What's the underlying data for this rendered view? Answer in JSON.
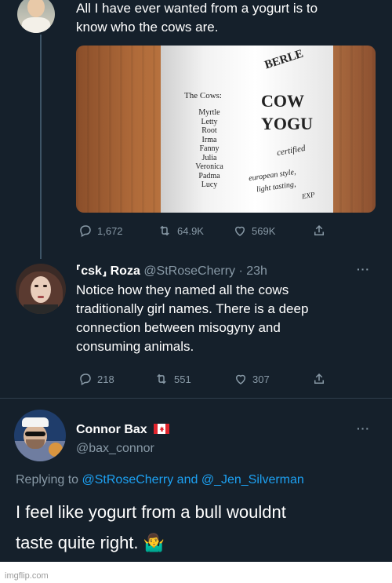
{
  "tweet1": {
    "text_line1": "All I have ever wanted from a yogurt is to",
    "text_line2": "know who the cows are.",
    "image": {
      "cows_heading": "The Cows:",
      "cow_names": [
        "Myrtle",
        "Letty",
        "Root",
        "Irma",
        "Fanny",
        "Julia",
        "Veronica",
        "Padma",
        "Lucy"
      ],
      "brand_top": "BERLE",
      "brand_line1": "COW",
      "brand_line2": "YOGU",
      "certified": "certified",
      "style_line1": "european style,",
      "style_line2": "light tasting,",
      "style_line3": "EXP"
    },
    "actions": {
      "reply": "1,672",
      "retweet": "64.9K",
      "like": "569K"
    }
  },
  "tweet2": {
    "display_name": "⸢csk⸥ Roza",
    "handle": "@StRoseCherry",
    "time": "· 23h",
    "more": "···",
    "text_lines": [
      "Notice how they named all the cows",
      "traditionally girl names. There is a deep",
      "connection between misogyny and",
      "consuming animals."
    ],
    "actions": {
      "reply": "218",
      "retweet": "551",
      "like": "307"
    }
  },
  "tweet3": {
    "display_name": "Connor Bax",
    "handle": "@bax_connor",
    "more": "···",
    "replying_prefix": "Replying to",
    "replying_user1": "@StRoseCherry",
    "replying_and": "and",
    "replying_user2": "@_Jen_Silverman",
    "text_line1": "I feel like yogurt from a bull wouldnt",
    "text_line2": "taste quite right. 🤷‍♂️"
  },
  "footer": "imgflip.com",
  "colors": {
    "background": "#15202b",
    "muted": "#8899a6",
    "link": "#1da1f2",
    "text": "#ffffff"
  }
}
